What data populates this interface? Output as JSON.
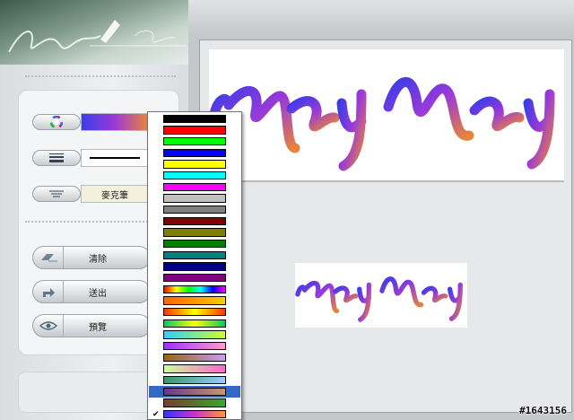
{
  "left_panel": {
    "tools": {
      "color_label": "",
      "brush_label": "麥克筆"
    },
    "buttons": {
      "clear_label": "清除",
      "send_label": "送出",
      "preview_label": "預覽"
    }
  },
  "canvas": {
    "drawing_text": "May May",
    "preview_text": "May May"
  },
  "dropdown": {
    "selected_index": 24,
    "options": [
      {
        "type": "solid",
        "colors": [
          "#000000"
        ]
      },
      {
        "type": "solid",
        "colors": [
          "#ff0000"
        ]
      },
      {
        "type": "solid",
        "colors": [
          "#00ff00"
        ]
      },
      {
        "type": "solid",
        "colors": [
          "#0000ff"
        ]
      },
      {
        "type": "solid",
        "colors": [
          "#ffff00"
        ]
      },
      {
        "type": "solid",
        "colors": [
          "#00ffff"
        ]
      },
      {
        "type": "solid",
        "colors": [
          "#ff00ff"
        ]
      },
      {
        "type": "solid",
        "colors": [
          "#c0c0c0"
        ]
      },
      {
        "type": "solid",
        "colors": [
          "#808080"
        ]
      },
      {
        "type": "solid",
        "colors": [
          "#800000"
        ]
      },
      {
        "type": "solid",
        "colors": [
          "#808000"
        ]
      },
      {
        "type": "solid",
        "colors": [
          "#008000"
        ]
      },
      {
        "type": "solid",
        "colors": [
          "#008080"
        ]
      },
      {
        "type": "solid",
        "colors": [
          "#000080"
        ]
      },
      {
        "type": "solid",
        "colors": [
          "#800080"
        ]
      },
      {
        "type": "gradient",
        "colors": [
          "#ff0000",
          "#ffff00",
          "#00ff00",
          "#00ffff",
          "#0000ff",
          "#ff00ff"
        ]
      },
      {
        "type": "gradient",
        "colors": [
          "#ff6600",
          "#ffcc00"
        ]
      },
      {
        "type": "gradient",
        "colors": [
          "#ff3300",
          "#ffff00",
          "#ff3300"
        ]
      },
      {
        "type": "gradient",
        "colors": [
          "#00cc66",
          "#ffff00",
          "#00cc66"
        ]
      },
      {
        "type": "gradient",
        "colors": [
          "#33ccff",
          "#ccff33"
        ]
      },
      {
        "type": "gradient",
        "colors": [
          "#9933ff",
          "#ff99cc"
        ]
      },
      {
        "type": "gradient",
        "colors": [
          "#996600",
          "#cc99ff"
        ]
      },
      {
        "type": "gradient",
        "colors": [
          "#ccff99",
          "#ff66cc"
        ]
      },
      {
        "type": "gradient",
        "colors": [
          "#339966",
          "#99ccff"
        ]
      },
      {
        "type": "gradient",
        "colors": [
          "#663399",
          "#cc9966"
        ]
      },
      {
        "type": "gradient",
        "colors": [
          "#7a3b2e",
          "#33aa33"
        ]
      },
      {
        "type": "gradient",
        "colors": [
          "#3333ff",
          "#cc33cc",
          "#ff9933"
        ]
      }
    ]
  },
  "colors": {
    "stroke_gradient": [
      "#3a3ce8",
      "#9b3ad8",
      "#e8843a"
    ],
    "selection": "#316ac5"
  },
  "watermark": "#1643156"
}
